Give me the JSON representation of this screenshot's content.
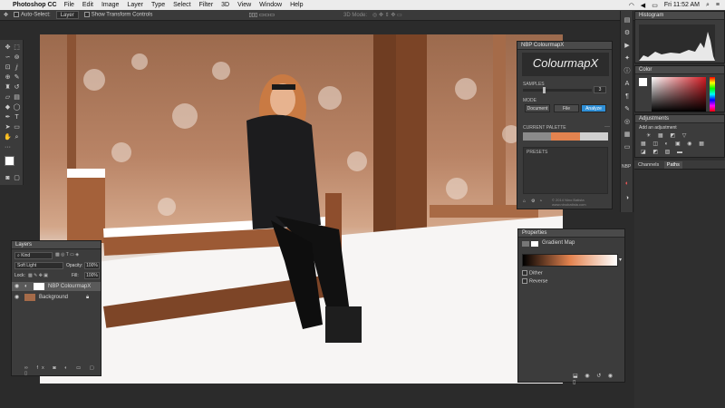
{
  "menubar": {
    "app_name": "Photoshop CC",
    "items": [
      "File",
      "Edit",
      "Image",
      "Layer",
      "Type",
      "Select",
      "Filter",
      "3D",
      "View",
      "Window",
      "Help"
    ],
    "time": "Fri 11:52 AM"
  },
  "options_bar": {
    "auto_select": "Auto-Select:",
    "auto_select_target": "Layer",
    "show_transform": "Show Transform Controls",
    "mode_3d": "3D Mode:"
  },
  "nbp_panel": {
    "title": "NBP ColourmapX",
    "logo_text": "ColourmapX",
    "samples_label": "SAMPLES",
    "samples_value": "3",
    "mode_label": "MODE",
    "mode_buttons": [
      "Document",
      "File",
      "Analyze"
    ],
    "current_palette_label": "CURRENT PALETTE",
    "presets_label": "PRESETS",
    "copyright": "© 2014 Nino Batista  www.ninobatista.com",
    "palette_colors": [
      "#8b8b8b",
      "#e3834f",
      "#cfcfcf"
    ]
  },
  "properties": {
    "title": "Properties",
    "layer_type": "Gradient Map",
    "dither": "Dither",
    "reverse": "Reverse",
    "gradient_colors": [
      "#000000",
      "#e3834f",
      "#ffffff"
    ]
  },
  "layers": {
    "title": "Layers",
    "kind": "Kind",
    "blend_mode": "Soft Light",
    "opacity_label": "Opacity:",
    "opacity_value": "100%",
    "lock_label": "Lock:",
    "fill_label": "Fill:",
    "fill_value": "100%",
    "rows": [
      {
        "name": "NBP ColourmapX"
      },
      {
        "name": "Background"
      }
    ]
  },
  "right_panels": {
    "histogram": "Histogram",
    "color": "Color",
    "adjustments": "Adjustments",
    "add_adjustment": "Add an adjustment",
    "channels": "Channels",
    "paths": "Paths"
  },
  "strip_labels": {
    "nbp": "NBP"
  },
  "colors": {
    "accent_blue": "#2f8fd6",
    "panel_bg": "#3c3c3c",
    "title_bg": "#4a4a4a"
  }
}
